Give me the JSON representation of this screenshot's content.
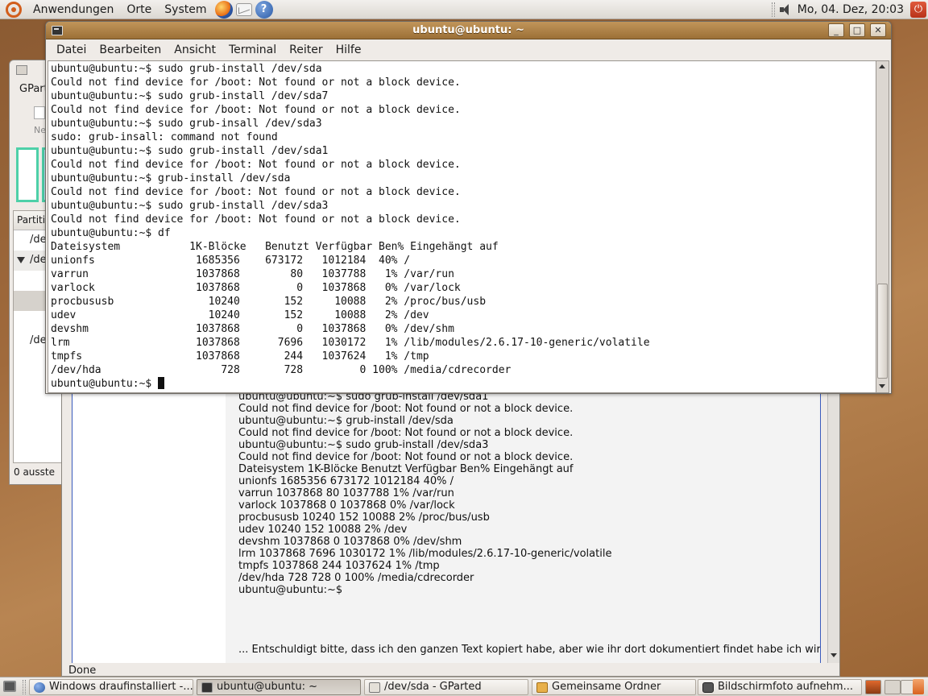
{
  "top_panel": {
    "menus": [
      "Anwendungen",
      "Orte",
      "System"
    ],
    "clock": "Mo, 04. Dez, 20:03"
  },
  "terminal": {
    "title": "ubuntu@ubuntu: ~",
    "menus": [
      "Datei",
      "Bearbeiten",
      "Ansicht",
      "Terminal",
      "Reiter",
      "Hilfe"
    ],
    "lines": [
      "ubuntu@ubuntu:~$ sudo grub-install /dev/sda",
      "Could not find device for /boot: Not found or not a block device.",
      "ubuntu@ubuntu:~$ sudo grub-install /dev/sda7",
      "Could not find device for /boot: Not found or not a block device.",
      "ubuntu@ubuntu:~$ sudo grub-insall /dev/sda3",
      "sudo: grub-insall: command not found",
      "ubuntu@ubuntu:~$ sudo grub-install /dev/sda1",
      "Could not find device for /boot: Not found or not a block device.",
      "ubuntu@ubuntu:~$ grub-install /dev/sda",
      "Could not find device for /boot: Not found or not a block device.",
      "ubuntu@ubuntu:~$ sudo grub-install /dev/sda3",
      "Could not find device for /boot: Not found or not a block device.",
      "ubuntu@ubuntu:~$ df",
      "Dateisystem           1K-Blöcke   Benutzt Verfügbar Ben% Eingehängt auf",
      "unionfs                1685356    673172   1012184  40% /",
      "varrun                 1037868        80   1037788   1% /var/run",
      "varlock                1037868         0   1037868   0% /var/lock",
      "procbususb               10240       152     10088   2% /proc/bus/usb",
      "udev                     10240       152     10088   2% /dev",
      "devshm                 1037868         0   1037868   0% /dev/shm",
      "lrm                    1037868      7696   1030172   1% /lib/modules/2.6.17-10-generic/volatile",
      "tmpfs                  1037868       244   1037624   1% /tmp",
      "/dev/hda                   728       728         0 100% /media/cdrecorder"
    ],
    "prompt": "ubuntu@ubuntu:~$ "
  },
  "gparted_bg": {
    "menu": "GPart",
    "new_label": "Ne",
    "column_header": "Partiti",
    "rows": [
      "/de",
      "/de",
      "",
      "",
      "",
      "/de"
    ],
    "status": "0 ausste"
  },
  "browser_bg": {
    "content_lines": [
      "ubuntu@ubuntu:~$ sudo grub-install /dev/sda1",
      "Could not find device for /boot: Not found or not a block device.",
      "ubuntu@ubuntu:~$ grub-install /dev/sda",
      "Could not find device for /boot: Not found or not a block device.",
      "ubuntu@ubuntu:~$ sudo grub-install /dev/sda3",
      "Could not find device for /boot: Not found or not a block device.",
      "Dateisystem 1K-Blöcke Benutzt Verfügbar Ben% Eingehängt auf",
      "unionfs 1685356 673172 1012184 40% /",
      "varrun 1037868 80 1037788 1% /var/run",
      "varlock 1037868 0 1037868 0% /var/lock",
      "procbususb 10240 152 10088 2% /proc/bus/usb",
      "udev 10240 152 10088 2% /dev",
      "devshm 1037868 0 1037868 0% /dev/shm",
      "lrm 1037868 7696 1030172 1% /lib/modules/2.6.17-10-generic/volatile",
      "tmpfs 1037868 244 1037624 1% /tmp",
      "/dev/hda 728 728 0 100% /media/cdrecorder",
      "ubuntu@ubuntu:~$"
    ],
    "note": "... Entschuldigt bitte, dass ich den ganzen Text kopiert habe, aber wie ihr dort dokumentiert findet habe ich wirklich keine Ahnung, was es sein könnte.",
    "status": "Done"
  },
  "taskbar": {
    "tasks": [
      {
        "label": "Windows draufinstalliert -...",
        "icon": "firefox-icon"
      },
      {
        "label": "ubuntu@ubuntu: ~",
        "icon": "terminal-icon"
      },
      {
        "label": "/dev/sda - GParted",
        "icon": "gparted-icon"
      },
      {
        "label": "Gemeinsame Ordner",
        "icon": "folder-icon"
      },
      {
        "label": "Bildschirmfoto aufnehm...",
        "icon": "camera-icon"
      }
    ]
  }
}
